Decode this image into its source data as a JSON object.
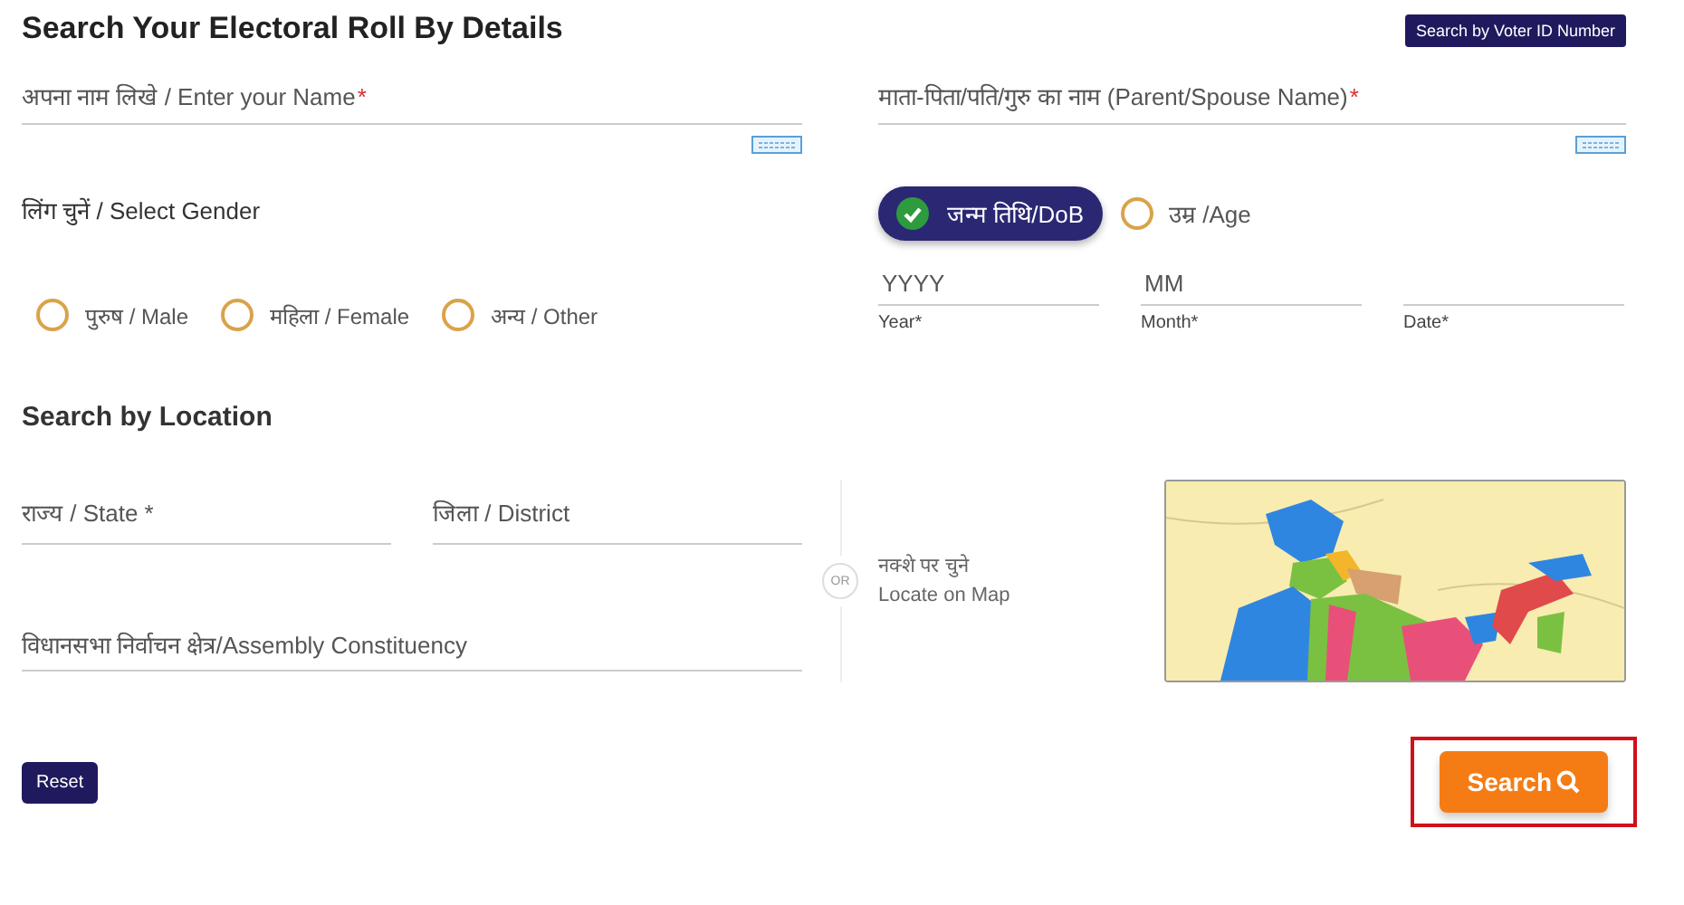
{
  "title": "Search Your Electoral Roll By Details",
  "voter_id_button": "Search by Voter ID Number",
  "name_field": {
    "placeholder": "अपना नाम लिखे / Enter your Name",
    "required_mark": "*"
  },
  "relative_field": {
    "placeholder": "माता-पिता/पति/गुरु का नाम (Parent/Spouse Name)",
    "required_mark": "*"
  },
  "gender": {
    "label": "लिंग चुनें / Select Gender",
    "options": [
      {
        "label": "पुरुष / Male",
        "selected": false
      },
      {
        "label": "महिला / Female",
        "selected": false
      },
      {
        "label": "अन्य / Other",
        "selected": false
      }
    ]
  },
  "age_mode": [
    {
      "label": "जन्म तिथि/DoB",
      "selected": true
    },
    {
      "label": "उम्र /Age",
      "selected": false
    }
  ],
  "dob_fields": [
    {
      "placeholder": "YYYY",
      "caption": "Year*"
    },
    {
      "placeholder": "MM",
      "caption": "Month*"
    },
    {
      "caption": "Date*"
    }
  ],
  "location": {
    "heading": "Search by Location",
    "state_field": {
      "placeholder": "राज्य / State *"
    },
    "district_field": {
      "placeholder": "जिला / District"
    },
    "assembly_field": {
      "placeholder": "विधानसभा निर्वाचन क्षेत्र/Assembly Constituency"
    },
    "or_label": "OR",
    "map_hint_hindi": "नक्शे पर चुने",
    "map_hint": "Locate on Map"
  },
  "reset_button": "Reset",
  "search_button": "Search"
}
